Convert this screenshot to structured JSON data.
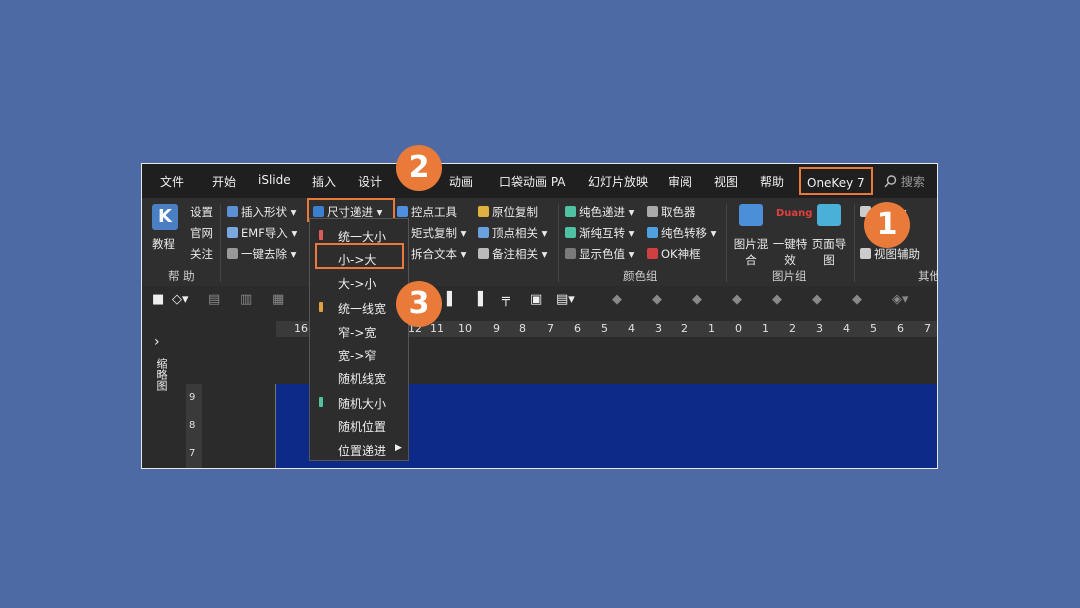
{
  "tabs": [
    "文件",
    "开始",
    "iSlide",
    "插入",
    "设计",
    "动画",
    "口袋动画 PA",
    "幻灯片放映",
    "审阅",
    "视图",
    "帮助",
    "OneKey 7"
  ],
  "search": "搜索",
  "ribbon": {
    "help": {
      "big": "教程",
      "items": [
        "设置",
        "官网",
        "关注"
      ],
      "label": "帮 助"
    },
    "col1": [
      "插入形状",
      "EMF导入",
      "一键去除"
    ],
    "col2": [
      "尺寸递进"
    ],
    "col3": [
      "控点工具",
      "矩式复制",
      "拆合文本"
    ],
    "col4": [
      "原位复制",
      "顶点相关",
      "备注相关"
    ],
    "col5": [
      "纯色递进",
      "渐纯互转",
      "显示色值"
    ],
    "col6": [
      "取色器",
      "纯色转移",
      "OK神框"
    ],
    "color_group": "颜色组",
    "pic": [
      "图片混合",
      "一键特效",
      "页面导图"
    ],
    "pic_group": "图片组",
    "other": [
      "截图",
      "视图辅助"
    ],
    "other_label": "其他"
  },
  "menu": [
    "统一大小",
    "小->大",
    "大->小",
    "统一线宽",
    "窄->宽",
    "宽->窄",
    "随机线宽",
    "随机大小",
    "随机位置",
    "位置递进"
  ],
  "ruler": [
    "16",
    "12",
    "11",
    "10",
    "9",
    "8",
    "7",
    "6",
    "5",
    "4",
    "3",
    "2",
    "1",
    "0",
    "1",
    "2",
    "3",
    "4",
    "5",
    "6",
    "7"
  ],
  "vruler": [
    "9",
    "8",
    "7"
  ],
  "pane_label": "缩略图",
  "badges": [
    "1",
    "2",
    "3"
  ],
  "colors": {
    "accent": "#ea7a3a",
    "bg": "#4e6aa4",
    "canvas": "#0e2a88"
  }
}
